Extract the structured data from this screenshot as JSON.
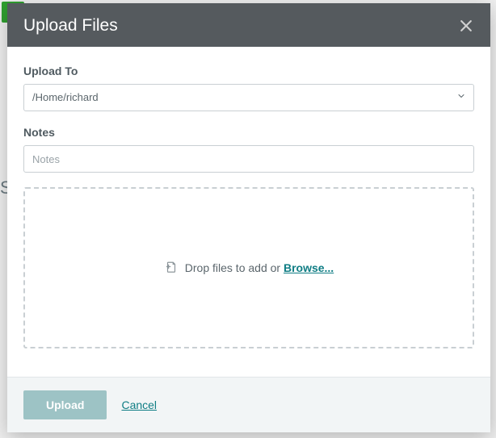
{
  "modal": {
    "title": "Upload Files"
  },
  "upload_to": {
    "label": "Upload To",
    "value": "/Home/richard"
  },
  "notes": {
    "label": "Notes",
    "placeholder": "Notes"
  },
  "dropzone": {
    "text": "Drop files to add or ",
    "browse_label": "Browse..."
  },
  "footer": {
    "upload_label": "Upload",
    "cancel_label": "Cancel"
  }
}
